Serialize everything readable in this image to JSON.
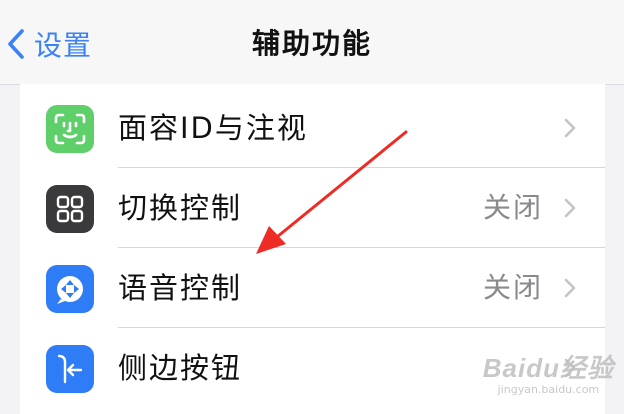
{
  "navbar": {
    "back_label": "设置",
    "title": "辅助功能"
  },
  "rows": [
    {
      "label": "面容ID与注视",
      "value": "",
      "icon": "face-id-icon",
      "icon_color": "#5fcf6a"
    },
    {
      "label": "切换控制",
      "value": "关闭",
      "icon": "switch-control-icon",
      "icon_color": "#3a3a3c"
    },
    {
      "label": "语音控制",
      "value": "关闭",
      "icon": "voice-control-icon",
      "icon_color": "#2e7cf6"
    },
    {
      "label": "侧边按钮",
      "value": "",
      "icon": "side-button-icon",
      "icon_color": "#2e7cf6"
    }
  ],
  "annotation": {
    "arrow_color": "#ee2b24"
  },
  "watermark": {
    "brand": "Baidu经验",
    "url": "jingyan.baidu.com"
  },
  "colors": {
    "accent": "#3b82f6",
    "background": "#f2f2f7"
  }
}
